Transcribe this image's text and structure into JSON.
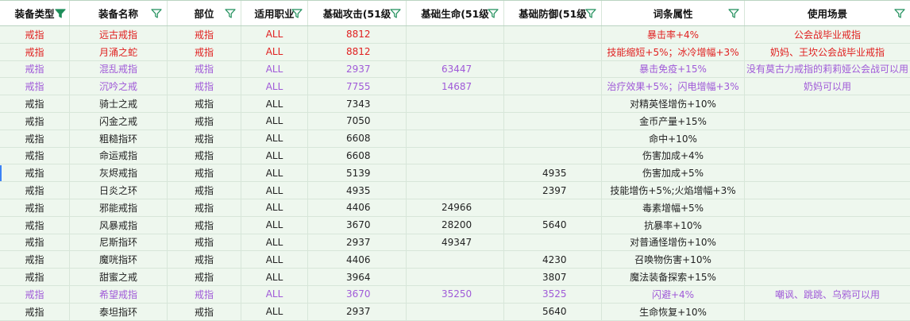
{
  "headers": [
    "装备类型",
    "装备名称",
    "部位",
    "适用职业",
    "基础攻击(51级",
    "基础生命(51级",
    "基础防御(51级",
    "词条属性",
    "使用场景"
  ],
  "rows": [
    {
      "style": "red",
      "cells": [
        "戒指",
        "远古戒指",
        "戒指",
        "ALL",
        "8812",
        "",
        "",
        "暴击率+4%",
        "公会战毕业戒指"
      ]
    },
    {
      "style": "red",
      "cells": [
        "戒指",
        "月涌之蛇",
        "戒指",
        "ALL",
        "8812",
        "",
        "",
        "技能缩短+5%；冰冷增幅+3%",
        "奶妈、王坎公会战毕业戒指"
      ]
    },
    {
      "style": "purple",
      "cells": [
        "戒指",
        "混乱戒指",
        "戒指",
        "ALL",
        "2937",
        "63447",
        "",
        "暴击免疫+15%",
        "没有莫古力戒指的莉莉娅公会战可以用"
      ]
    },
    {
      "style": "purple",
      "cells": [
        "戒指",
        "沉吟之戒",
        "戒指",
        "ALL",
        "7755",
        "14687",
        "",
        "治疗效果+5%；闪电增幅+3%",
        "奶妈可以用"
      ]
    },
    {
      "style": "normal",
      "cells": [
        "戒指",
        "骑士之戒",
        "戒指",
        "ALL",
        "7343",
        "",
        "",
        "对精英怪增伤+10%",
        ""
      ]
    },
    {
      "style": "normal",
      "cells": [
        "戒指",
        "闪金之戒",
        "戒指",
        "ALL",
        "7050",
        "",
        "",
        "金币产量+15%",
        ""
      ]
    },
    {
      "style": "normal",
      "cells": [
        "戒指",
        "粗糙指环",
        "戒指",
        "ALL",
        "6608",
        "",
        "",
        "命中+10%",
        ""
      ]
    },
    {
      "style": "normal",
      "cells": [
        "戒指",
        "命运戒指",
        "戒指",
        "ALL",
        "6608",
        "",
        "",
        "伤害加成+4%",
        ""
      ]
    },
    {
      "style": "normal",
      "cells": [
        "戒指",
        "灰烬戒指",
        "戒指",
        "ALL",
        "5139",
        "",
        "4935",
        "伤害加成+5%",
        ""
      ]
    },
    {
      "style": "normal",
      "cells": [
        "戒指",
        "日炎之环",
        "戒指",
        "ALL",
        "4935",
        "",
        "2397",
        "技能增伤+5%;火焰增幅+3%",
        ""
      ]
    },
    {
      "style": "normal",
      "cells": [
        "戒指",
        "邪能戒指",
        "戒指",
        "ALL",
        "4406",
        "24966",
        "",
        "毒素增幅+5%",
        ""
      ]
    },
    {
      "style": "normal",
      "cells": [
        "戒指",
        "风暴戒指",
        "戒指",
        "ALL",
        "3670",
        "28200",
        "5640",
        "抗暴率+10%",
        ""
      ]
    },
    {
      "style": "normal",
      "cells": [
        "戒指",
        "尼斯指环",
        "戒指",
        "ALL",
        "2937",
        "49347",
        "",
        "对普通怪增伤+10%",
        ""
      ]
    },
    {
      "style": "normal",
      "cells": [
        "戒指",
        "魔咣指环",
        "戒指",
        "ALL",
        "4406",
        "",
        "4230",
        "召唤物伤害+10%",
        ""
      ]
    },
    {
      "style": "normal",
      "cells": [
        "戒指",
        "甜蜜之戒",
        "戒指",
        "ALL",
        "3964",
        "",
        "3807",
        "魔法装备探索+15%",
        ""
      ]
    },
    {
      "style": "purple",
      "cells": [
        "戒指",
        "希望戒指",
        "戒指",
        "ALL",
        "3670",
        "35250",
        "3525",
        "闪避+4%",
        "嘲讽、跳跳、乌鸦可以用"
      ]
    },
    {
      "style": "normal",
      "cells": [
        "戒指",
        "泰坦指环",
        "戒指",
        "ALL",
        "2937",
        "",
        "5640",
        "生命恢复+10%",
        ""
      ]
    }
  ]
}
